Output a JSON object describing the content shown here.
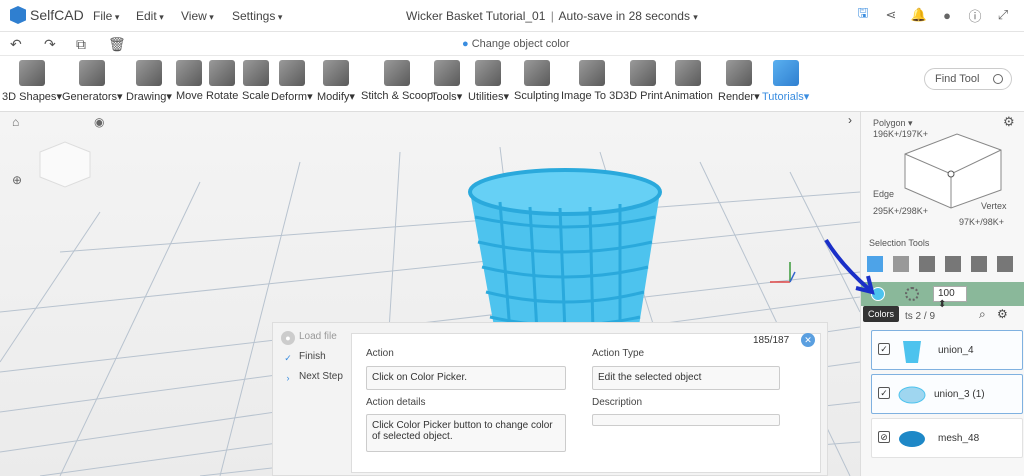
{
  "app": {
    "logo_text": "SelfCAD"
  },
  "menus": [
    "File",
    "Edit",
    "View",
    "Settings"
  ],
  "title": {
    "doc_name": "Wicker Basket Tutorial_01",
    "autosave": "Auto-save in 28 seconds"
  },
  "status": {
    "text": "Change object color"
  },
  "toolbar": [
    "3D Shapes",
    "Generators",
    "Drawing",
    "Move",
    "Rotate",
    "Scale",
    "Deform",
    "Modify",
    "Stitch & Scoop",
    "Tools",
    "Utilities",
    "Sculpting",
    "Image To 3D",
    "3D Print",
    "Animation",
    "Render",
    "Tutorials"
  ],
  "find_tool": {
    "placeholder": "Find Tool"
  },
  "right_panel": {
    "polygon_label": "Polygon",
    "polygon_count": "196K+/197K+",
    "edge_label": "Edge",
    "edge_count": "295K+/298K+",
    "vertex_label": "Vertex",
    "vertex_count": "97K+/98K+",
    "selection_tools": "Selection Tools",
    "opacity_value": "100",
    "colors_tooltip": "Colors",
    "objects_label": "ts 2 / 9",
    "objects": [
      {
        "name": "union_4",
        "checked": true
      },
      {
        "name": "union_3 (1)",
        "checked": true
      },
      {
        "name": "mesh_48",
        "checked": false
      }
    ]
  },
  "tutorial": {
    "steps": [
      {
        "label": "Load file",
        "state": "muted"
      },
      {
        "label": "Finish",
        "state": "done"
      },
      {
        "label": "Next Step",
        "state": "next"
      }
    ],
    "counter": "185/187",
    "action_label": "Action",
    "action_value": "Click on Color Picker.",
    "action_details_label": "Action details",
    "action_details_value": "Click Color Picker button to change color of selected object.",
    "action_type_label": "Action Type",
    "action_type_value": "Edit the selected object",
    "description_label": "Description",
    "description_value": ""
  },
  "colors": {
    "accent": "#3a8de0",
    "model": "#4dc3ee",
    "panel_green": "#8ab89a",
    "annotation_arrow": "#1a2fc8"
  }
}
